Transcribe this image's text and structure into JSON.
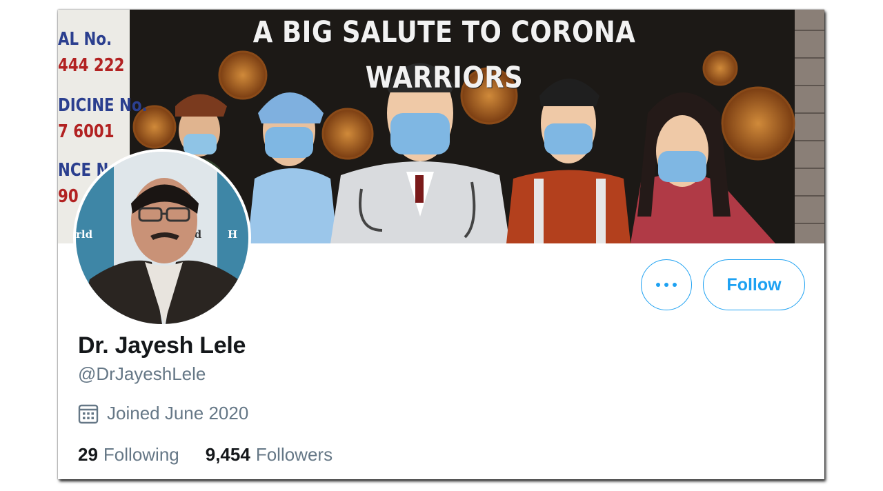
{
  "banner": {
    "headline": "A BIG SALUTE TO CORONA WARRIORS",
    "notice_lines": [
      "AL  No.",
      "444 222",
      "DICINE No.",
      "7 6001",
      "NCE N",
      "90"
    ],
    "avatar_backdrop_text": [
      "rld",
      "orld",
      "H"
    ]
  },
  "profile": {
    "display_name": "Dr. Jayesh Lele",
    "handle": "@DrJayeshLele",
    "joined": "Joined June 2020",
    "following_count": "29",
    "following_label": "Following",
    "followers_count": "9,454",
    "followers_label": "Followers"
  },
  "actions": {
    "more_icon": "more-horizontal-icon",
    "follow_label": "Follow"
  },
  "icons": {
    "joined": "calendar-icon"
  },
  "colors": {
    "accent": "#1da1f2",
    "primary_text": "#14171a",
    "secondary_text": "#657786"
  }
}
